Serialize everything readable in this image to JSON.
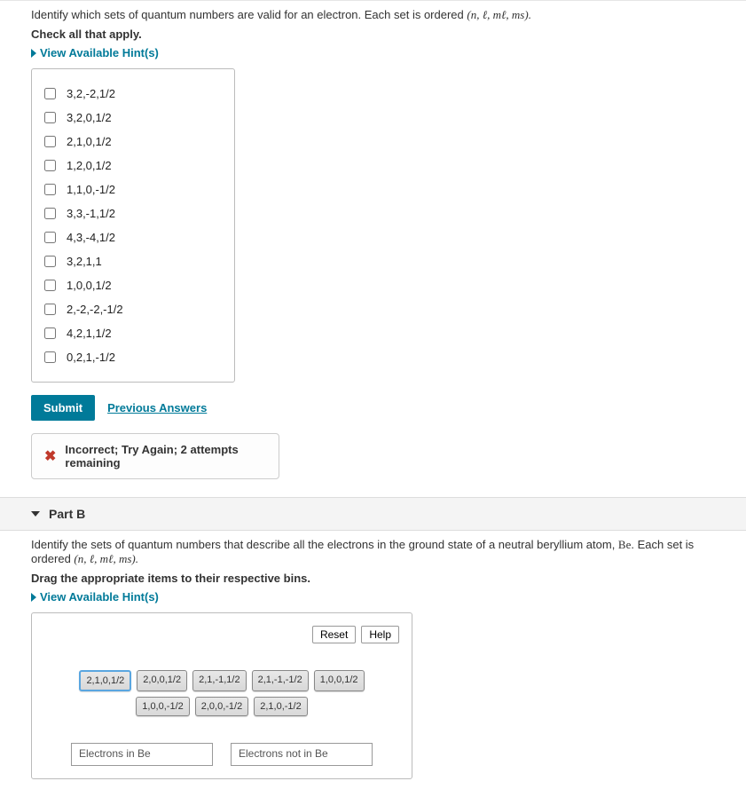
{
  "partA": {
    "prompt_prefix": "Identify which sets of quantum numbers are valid for an electron. Each set is ordered ",
    "prompt_math": "(n, ℓ, mℓ, ms).",
    "check_all": "Check all that apply.",
    "hints_label": "View Available Hint(s)",
    "options": [
      "3,2,-2,1/2",
      "3,2,0,1/2",
      "2,1,0,1/2",
      "1,2,0,1/2",
      "1,1,0,-1/2",
      "3,3,-1,1/2",
      "4,3,-4,1/2",
      "3,2,1,1",
      "1,0,0,1/2",
      "2,-2,-2,-1/2",
      "4,2,1,1/2",
      "0,2,1,-1/2"
    ],
    "submit_label": "Submit",
    "prev_answers": "Previous Answers",
    "feedback": "Incorrect; Try Again; 2 attempts remaining"
  },
  "partB": {
    "header": "Part B",
    "prompt_prefix": "Identify the sets of quantum numbers that describe all the electrons in the ground state of a neutral beryllium atom, ",
    "atom": "Be",
    "prompt_suffix": ". Each set is ordered ",
    "prompt_math": "(n, ℓ, mℓ, ms).",
    "drag_instr": "Drag the appropriate items to their respective bins.",
    "hints_label": "View Available Hint(s)",
    "reset_label": "Reset",
    "help_label": "Help",
    "items": [
      "2,1,0,1/2",
      "2,0,0,1/2",
      "2,1,-1,1/2",
      "2,1,-1,-1/2",
      "1,0,0,1/2",
      "1,0,0,-1/2",
      "2,0,0,-1/2",
      "2,1,0,-1/2"
    ],
    "bin1": "Electrons in Be",
    "bin2": "Electrons not in Be"
  }
}
